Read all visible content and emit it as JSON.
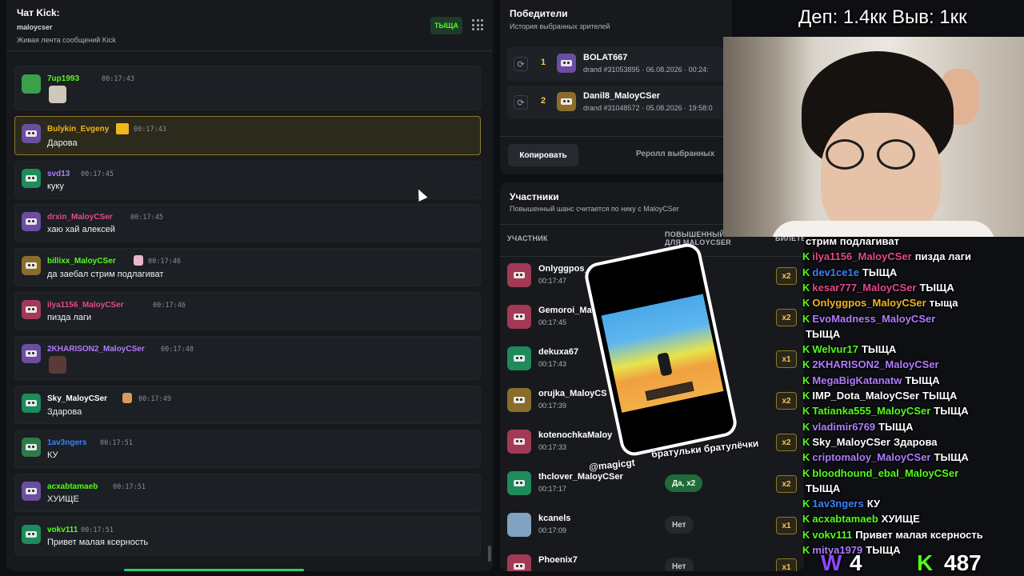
{
  "chat": {
    "title": "Чат Kick:",
    "channel": "maloycser",
    "subtitle": "Живая лента сообщений Kick",
    "badge": "ТЫЩА",
    "messages": [
      {
        "name": "7up1993",
        "time": "00:17:43",
        "text": "",
        "name_color": "#53fc18",
        "avatar_color": "#3aa04a"
      },
      {
        "name": "Bulykin_Evgeny",
        "time": "00:17:43",
        "text": "Дарова",
        "name_color": "#f2b61d",
        "avatar_color": "#6b4ea0"
      },
      {
        "name": "svd13",
        "time": "00:17:45",
        "text": "куку",
        "name_color": "#b07cff",
        "avatar_color": "#1f8a5a"
      },
      {
        "name": "drxin_MaloyCSer",
        "time": "00:17:45",
        "text": "хаю хай алексей",
        "name_color": "#e24a8b",
        "avatar_color": "#6b4ea0"
      },
      {
        "name": "billixx_MaloyCSer",
        "time": "00:17:46",
        "text": "да заебал стрим подлагиват",
        "name_color": "#53fc18",
        "avatar_color": "#8a6d2a"
      },
      {
        "name": "ilya1156_MaloyCSer",
        "time": "00:17:46",
        "text": "пизда лаги",
        "name_color": "#e24a8b",
        "avatar_color": "#a33a55"
      },
      {
        "name": "2KHARISON2_MaloyCSer",
        "time": "00:17:48",
        "text": "",
        "name_color": "#b07cff",
        "avatar_color": "#6b4ea0"
      },
      {
        "name": "Sky_MaloyCSer",
        "time": "00:17:49",
        "text": "Здарова",
        "name_color": "#ffffff",
        "avatar_color": "#1f8a5a"
      },
      {
        "name": "1av3ngers",
        "time": "00:17:51",
        "text": "КУ",
        "name_color": "#3b82f6",
        "avatar_color": "#2f7a4a"
      },
      {
        "name": "acxabtamaeb",
        "time": "00:17:51",
        "text": "ХУИЩЕ",
        "name_color": "#53fc18",
        "avatar_color": "#6b4ea0"
      },
      {
        "name": "vokv111",
        "time": "00:17:51",
        "text": "Привет малая ксерность",
        "name_color": "#53fc18",
        "avatar_color": "#1f8a5a"
      }
    ]
  },
  "winners": {
    "title": "Победители",
    "subtitle": "История выбранных зрителей",
    "rows": [
      {
        "rank": "1",
        "name": "BOLAT667",
        "meta": "drand #31053895 · 06.08.2026 · 00:24:",
        "avatar_color": "#6b4ea0"
      },
      {
        "rank": "2",
        "name": "Danil8_MaloyCSer",
        "meta": "drand #31048572 · 05.08.2026 · 19:58:0",
        "avatar_color": "#8a6d2a"
      }
    ],
    "copy_label": "Копировать",
    "reroll_label": "Реролл выбранных"
  },
  "participants": {
    "title": "Участники",
    "subtitle": "Повышенный шанс считается по нику с MaloyCSer",
    "col_participant": "УЧАСТНИК",
    "col_boost_1": "ПОВЫШЕННЫЙ ШАНС",
    "col_boost_2": "ДЛЯ MALOYCSER",
    "col_tickets": "БИЛЕТЫ",
    "rows": [
      {
        "name": "Onlyggpos_",
        "time": "00:17:47",
        "chance": "",
        "tickets": "x2",
        "avatar_color": "#a33a55"
      },
      {
        "name": "Gemoroi_Ma",
        "time": "00:17:45",
        "chance": "",
        "tickets": "x2",
        "avatar_color": "#a33a55"
      },
      {
        "name": "dekuxa67",
        "time": "00:17:43",
        "chance": "",
        "tickets": "x1",
        "avatar_color": "#1f8a5a"
      },
      {
        "name": "orujka_MaloyCS",
        "time": "00:17:39",
        "chance": "",
        "tickets": "x2",
        "avatar_color": "#8a6d2a"
      },
      {
        "name": "kotenochkaMaloy",
        "time": "00:17:33",
        "chance": "",
        "tickets": "x2",
        "avatar_color": "#a33a55"
      },
      {
        "name": "thclover_MaloyCSer",
        "time": "00:17:17",
        "chance": "Да, x2",
        "chance_type": "yes",
        "tickets": "x2",
        "avatar_color": "#1f8a5a"
      },
      {
        "name": "kcanels",
        "time": "00:17:09",
        "chance": "Нет",
        "chance_type": "no",
        "tickets": "x1",
        "avatar_color": "#7fa3c0"
      },
      {
        "name": "Phoenix7",
        "time": "",
        "chance": "Нет",
        "chance_type": "no",
        "tickets": "x1",
        "avatar_color": "#a33a55"
      }
    ]
  },
  "stream_overlay": {
    "top_text": "Деп: 1.4кк Выв: 1кк",
    "phone_caption": "братульки братулёчки",
    "phone_handle": "@magicgt",
    "chat_lines": [
      {
        "user": "",
        "text": "стрим подлагиват",
        "user_color": "#ffffff",
        "k": false
      },
      {
        "user": "ilya1156_MaloyCSer",
        "text": "пизда лаги",
        "user_color": "#e24a8b",
        "k": true
      },
      {
        "user": "dev1ce1e",
        "text": "ТЫЩА",
        "user_color": "#3b82f6",
        "k": true
      },
      {
        "user": "kesar777_MaloyCSer",
        "text": "ТЫЩА",
        "user_color": "#e24a8b",
        "k": true
      },
      {
        "user": "Onlyggpos_MaloyCSer",
        "text": "тыща",
        "user_color": "#f2b61d",
        "k": true
      },
      {
        "user": "EvoMadness_MaloyCSer",
        "text": "",
        "user_color": "#b07cff",
        "k": true
      },
      {
        "user": "",
        "text": "ТЫЩА",
        "user_color": "#ffffff",
        "k": false
      },
      {
        "user": "Welvur17",
        "text": "ТЫЩА",
        "user_color": "#53fc18",
        "k": true
      },
      {
        "user": "2KHARISON2_MaloyCSer",
        "text": "",
        "user_color": "#b07cff",
        "k": true
      },
      {
        "user": "MegaBigKatanatw",
        "text": "ТЫЩА",
        "user_color": "#b07cff",
        "k": true
      },
      {
        "user": "IMP_Dota_MaloyCSer",
        "text": "ТЫЩА",
        "user_color": "#ffffff",
        "k": true
      },
      {
        "user": "Tatianka555_MaloyCSer",
        "text": "ТЫЩА",
        "user_color": "#53fc18",
        "k": true
      },
      {
        "user": "vladimir6769",
        "text": "ТЫЩА",
        "user_color": "#b07cff",
        "k": true
      },
      {
        "user": "Sky_MaloyCSer",
        "text": "Здарова",
        "user_color": "#ffffff",
        "k": true
      },
      {
        "user": "criptomaloy_MaloyCSer",
        "text": "ТЫЩА",
        "user_color": "#b07cff",
        "k": true
      },
      {
        "user": "bloodhound_ebal_MaloyCSer",
        "text": "",
        "user_color": "#53fc18",
        "k": true
      },
      {
        "user": "",
        "text": "ТЫЩА",
        "user_color": "#ffffff",
        "k": false
      },
      {
        "user": "1av3ngers",
        "text": "КУ",
        "user_color": "#3b82f6",
        "k": true
      },
      {
        "user": "acxabtamaeb",
        "text": "ХУИЩЕ",
        "user_color": "#53fc18",
        "k": true
      },
      {
        "user": "vokv111",
        "text": "Привет малая ксерность",
        "user_color": "#53fc18",
        "k": true
      },
      {
        "user": "mitya1979",
        "text": "ТЫЩА",
        "user_color": "#b07cff",
        "k": true
      }
    ],
    "twitch_count": "4",
    "kick_count": "487"
  }
}
